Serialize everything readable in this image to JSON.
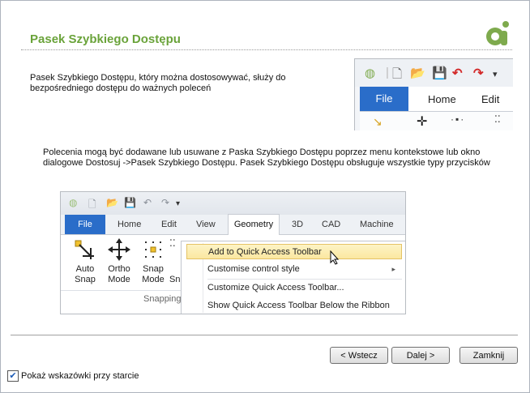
{
  "header": {
    "title": "Pasek Szybkiego Dostępu"
  },
  "intro": {
    "text": "Pasek Szybkiego Dostępu, który można dostosowywać, służy do bezpośredniego dostępu do ważnych poleceń"
  },
  "description": {
    "text": "Polecenia mogą być dodawane lub usuwane z Paska Szybkiego Dostępu poprzez menu kontekstowe lub okno dialogowe Dostosuj ->Pasek Szybkiego Dostępu. Pasek Szybkiego Dostępu obsługuje wszystkie typy przycisków"
  },
  "screenshot1": {
    "tabs": {
      "file": "File",
      "home": "Home",
      "edit": "Edit"
    }
  },
  "screenshot2": {
    "tabs": {
      "file": "File",
      "home": "Home",
      "edit": "Edit",
      "view": "View",
      "geometry": "Geometry",
      "3d": "3D",
      "cad": "CAD",
      "machine": "Machine"
    },
    "tools": {
      "auto_snap_1": "Auto",
      "auto_snap_2": "Snap",
      "ortho_1": "Ortho",
      "ortho_2": "Mode",
      "snap_mode_1": "Snap",
      "snap_mode_2": "Mode",
      "sn": "Sn"
    },
    "group_label": "Snapping",
    "menu": {
      "add": "Add to Quick Access Toolbar",
      "customise_style": "Customise control style",
      "customize_qat": "Customize Quick Access Toolbar...",
      "show_below": "Show Quick Access Toolbar Below the Ribbon"
    }
  },
  "footer": {
    "back_label": "< Wstecz",
    "next_label": "Dalej >",
    "close_label": "Zamknij",
    "startup_checkbox_label": "Pokaż wskazówki przy starcie",
    "startup_checked": true
  },
  "colors": {
    "title_green": "#6aa33a",
    "file_tab_blue": "#2a6dc9"
  }
}
